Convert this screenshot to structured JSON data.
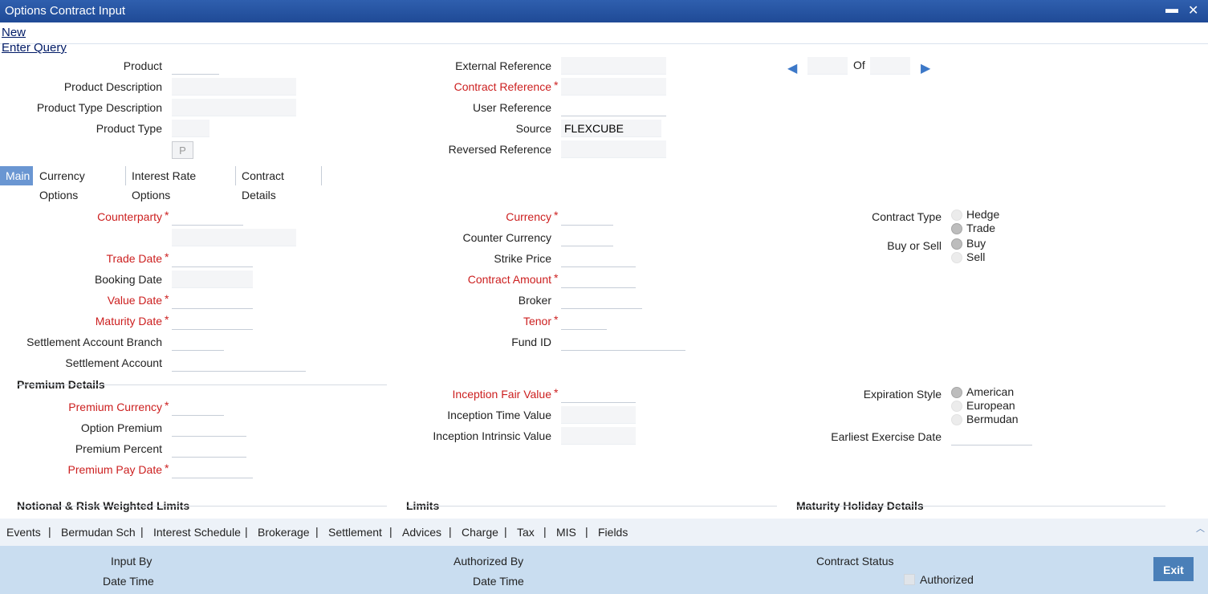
{
  "window": {
    "title": "Options Contract Input",
    "minimize": "▬",
    "close": "✕"
  },
  "menu": {
    "new": "New",
    "enter_query": "Enter Query"
  },
  "header_left": {
    "product": "Product",
    "product_description": "Product Description",
    "product_type_description": "Product Type Description",
    "product_type": "Product Type",
    "p_button": "P"
  },
  "header_mid": {
    "external_reference": "External Reference",
    "contract_reference": "Contract Reference",
    "user_reference": "User Reference",
    "source": "Source",
    "source_value": "FLEXCUBE",
    "reversed_reference": "Reversed Reference"
  },
  "pager": {
    "of": "Of",
    "prev": "◀",
    "next": "▶"
  },
  "tabs": [
    "Main",
    "Currency Options",
    "Interest Rate Options",
    "Contract Details"
  ],
  "main_left": {
    "counterparty": "Counterparty",
    "trade_date": "Trade Date",
    "booking_date": "Booking Date",
    "value_date": "Value Date",
    "maturity_date": "Maturity Date",
    "settlement_account_branch": "Settlement Account Branch",
    "settlement_account": "Settlement Account"
  },
  "main_mid": {
    "currency": "Currency",
    "counter_currency": "Counter Currency",
    "strike_price": "Strike Price",
    "contract_amount": "Contract Amount",
    "broker": "Broker",
    "tenor": "Tenor",
    "fund_id": "Fund ID"
  },
  "main_right": {
    "contract_type": "Contract Type",
    "contract_type_options": [
      "Hedge",
      "Trade"
    ],
    "buy_or_sell": "Buy or Sell",
    "buy_or_sell_options": [
      "Buy",
      "Sell"
    ],
    "expiration_style": "Expiration Style",
    "expiration_style_options": [
      "American",
      "European",
      "Bermudan"
    ],
    "earliest_exercise_date": "Earliest Exercise Date"
  },
  "premium": {
    "section": "Premium Details",
    "premium_currency": "Premium Currency",
    "option_premium": "Option Premium",
    "premium_percent": "Premium Percent",
    "premium_pay_date": "Premium Pay Date"
  },
  "inception": {
    "fair_value": "Inception Fair Value",
    "time_value": "Inception Time Value",
    "intrinsic_value": "Inception Intrinsic Value"
  },
  "sections": {
    "notional": "Notional & Risk Weighted Limits",
    "limits": "Limits",
    "maturity_holiday": "Maturity Holiday Details"
  },
  "toolbar": [
    "Events",
    "Bermudan Sch",
    "Interest Schedule",
    "Brokerage",
    "Settlement",
    "Advices",
    "Charge",
    "Tax",
    "MIS",
    "Fields"
  ],
  "footer": {
    "input_by": "Input By",
    "date_time_1": "Date Time",
    "authorized_by": "Authorized By",
    "date_time_2": "Date Time",
    "contract_status": "Contract Status",
    "authorized": "Authorized",
    "exit": "Exit"
  },
  "required_mark": "*"
}
